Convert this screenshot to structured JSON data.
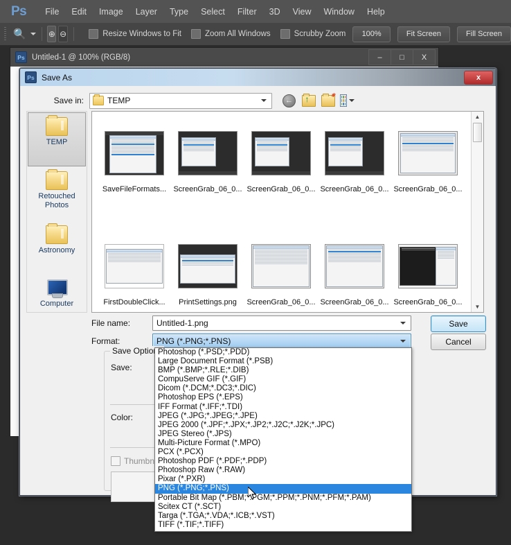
{
  "app": {
    "logo": "Ps",
    "menus": [
      "File",
      "Edit",
      "Image",
      "Layer",
      "Type",
      "Select",
      "Filter",
      "3D",
      "View",
      "Window",
      "Help"
    ],
    "options_bar": {
      "tool_icon": "magnifier-icon",
      "zoom_in_icon": "zoom-in-icon",
      "zoom_out_icon": "zoom-out-icon",
      "checkboxes": [
        {
          "label": "Resize Windows to Fit",
          "checked": false
        },
        {
          "label": "Zoom All Windows",
          "checked": false
        },
        {
          "label": "Scrubby Zoom",
          "checked": false
        }
      ],
      "buttons": [
        "100%",
        "Fit Screen",
        "Fill Screen"
      ]
    }
  },
  "document_window": {
    "badge": "Ps",
    "title": "Untitled-1 @ 100% (RGB/8)",
    "minimize": "–",
    "maximize": "□",
    "close": "X"
  },
  "save_as": {
    "badge": "Ps",
    "title": "Save As",
    "close_label": "x",
    "save_in": {
      "label": "Save in:",
      "value": "TEMP",
      "icons": [
        "back-icon",
        "up-folder-icon",
        "new-folder-icon",
        "views-icon"
      ]
    },
    "places": [
      {
        "label": "TEMP",
        "icon": "folder-icon",
        "selected": true
      },
      {
        "label": "Retouched Photos",
        "icon": "folder-icon",
        "selected": false
      },
      {
        "label": "Astronomy",
        "icon": "folder-icon",
        "selected": false
      },
      {
        "label": "Computer",
        "icon": "computer-icon",
        "selected": false
      }
    ],
    "files": [
      {
        "name": "SaveFileFormats...",
        "style": "dark-left"
      },
      {
        "name": "ScreenGrab_06_0...",
        "style": "dark"
      },
      {
        "name": "ScreenGrab_06_0...",
        "style": "dark"
      },
      {
        "name": "ScreenGrab_06_0...",
        "style": "dark"
      },
      {
        "name": "ScreenGrab_06_0...",
        "style": "light"
      },
      {
        "name": "FirstDoubleClick...",
        "style": "light"
      },
      {
        "name": "PrintSettings.png",
        "style": "dark"
      },
      {
        "name": "ScreenGrab_06_0...",
        "style": "light"
      },
      {
        "name": "ScreenGrab_06_0...",
        "style": "light"
      },
      {
        "name": "ScreenGrab_06_0...",
        "style": "mixed"
      }
    ],
    "file_name": {
      "label": "File name:",
      "value": "Untitled-1.png"
    },
    "format": {
      "label": "Format:",
      "value": "PNG (*.PNG;*.PNS)"
    },
    "buttons": {
      "save": "Save",
      "cancel": "Cancel"
    },
    "save_options": {
      "group_title": "Save Options",
      "save_label": "Save:",
      "color_label": "Color:",
      "thumbnail_label": "Thumbnail"
    },
    "format_dropdown": {
      "selected": "PNG (*.PNG;*.PNS)",
      "options": [
        "Photoshop (*.PSD;*.PDD)",
        "Large Document Format (*.PSB)",
        "BMP (*.BMP;*.RLE;*.DIB)",
        "CompuServe GIF (*.GIF)",
        "Dicom (*.DCM;*.DC3;*.DIC)",
        "Photoshop EPS (*.EPS)",
        "IFF Format (*.IFF;*.TDI)",
        "JPEG (*.JPG;*.JPEG;*.JPE)",
        "JPEG 2000 (*.JPF;*.JPX;*.JP2;*.J2C;*.J2K;*.JPC)",
        "JPEG Stereo (*.JPS)",
        "Multi-Picture Format (*.MPO)",
        "PCX (*.PCX)",
        "Photoshop PDF (*.PDF;*.PDP)",
        "Photoshop Raw (*.RAW)",
        "Pixar (*.PXR)",
        "PNG (*.PNG;*.PNS)",
        "Portable Bit Map (*.PBM;*.PGM;*.PPM;*.PNM;*.PFM;*.PAM)",
        "Scitex CT (*.SCT)",
        "Targa (*.TGA;*.VDA;*.ICB;*.VST)",
        "TIFF (*.TIF;*.TIFF)"
      ]
    }
  },
  "colors": {
    "ps_chrome": "#535353",
    "ps_options": "#454545",
    "dialog_bg": "#f0f0f0",
    "selection_blue": "#2a86de",
    "title_gradient_start": "#b9d5ee",
    "place_label": "#17375e"
  }
}
